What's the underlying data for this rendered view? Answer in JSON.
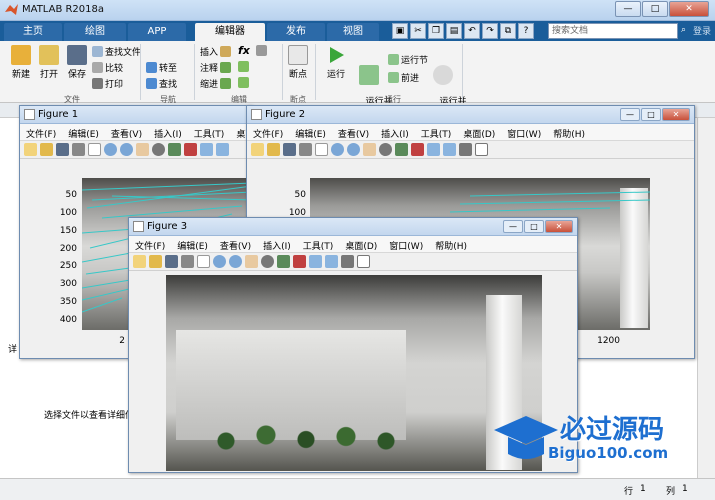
{
  "app": {
    "title": "MATLAB R2018a"
  },
  "tabs": [
    "主页",
    "绘图",
    "APP",
    "编辑器",
    "发布",
    "视图"
  ],
  "active_tab": "编辑器",
  "search": {
    "placeholder": "搜索文档"
  },
  "help_label": "登录",
  "ribbon": {
    "file": {
      "new": "新建",
      "open": "打开",
      "save": "保存",
      "find_files": "查找文件",
      "compare": "比较",
      "print": "打印",
      "group": "文件"
    },
    "navigate": {
      "goto": "转至",
      "find": "查找",
      "group": "导航"
    },
    "edit": {
      "insert": "插入",
      "comment": "注释",
      "indent": "缩进",
      "group": "编辑",
      "fx": "fx"
    },
    "breakpoints": {
      "label": "断点",
      "group": "断点"
    },
    "run": {
      "run": "运行",
      "run_advance": "运行并\n前进",
      "run_section": "运行节",
      "advance": "前进",
      "run_time": "运行并\n计时",
      "group": "运行"
    }
  },
  "main": {
    "detail_text": "选择文件以查看详细信",
    "side_letter": "详"
  },
  "status": {
    "row_label": "行",
    "row": "1",
    "col_label": "列",
    "col": "1"
  },
  "figure_menu": [
    "文件(F)",
    "编辑(E)",
    "查看(V)",
    "插入(I)",
    "工具(T)",
    "桌面(D)",
    "窗口(W)",
    "帮助(H)"
  ],
  "figures": [
    {
      "title": "Figure 1",
      "yticks": [
        "50",
        "100",
        "150",
        "200",
        "250",
        "300",
        "350",
        "400"
      ],
      "xtick": "2"
    },
    {
      "title": "Figure 2",
      "yticks": [
        "50",
        "100",
        "150",
        "200",
        "250",
        "300",
        "350",
        "400"
      ],
      "xtick": "1200"
    },
    {
      "title": "Figure 3"
    }
  ],
  "watermark": {
    "brand": "必过源码",
    "url": "Biguo100.com"
  },
  "colors": {
    "tabbar": "#1a5d9a",
    "match_lines": "#37c8c8",
    "brand": "#1e6fd0"
  }
}
